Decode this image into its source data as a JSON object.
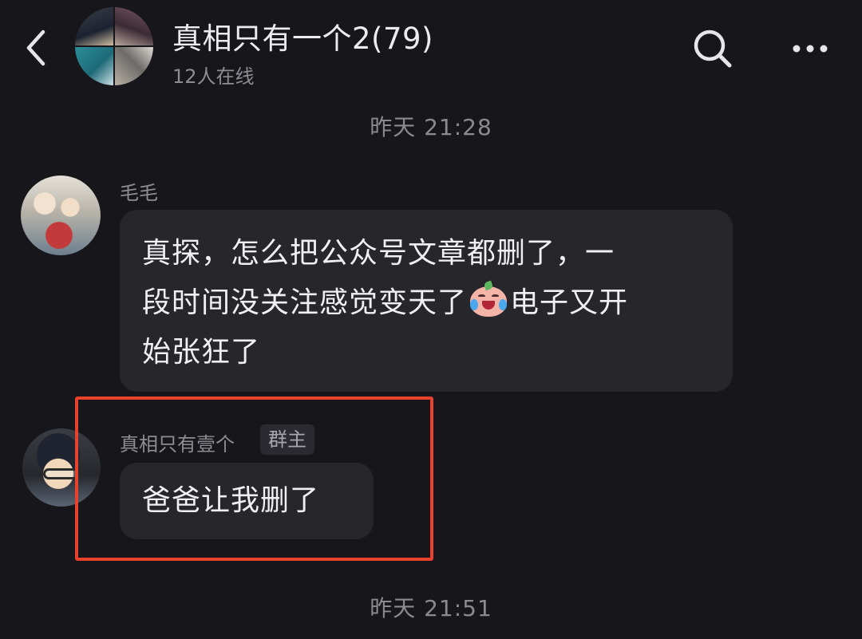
{
  "header": {
    "title": "真相只有一个2(79)",
    "online_status": "12人在线"
  },
  "messages": [
    {
      "timestamp": "昨天 21:28",
      "sender": "毛毛",
      "text_lines": [
        "真探，怎么把公众号文章都删了，一",
        "段时间没关注感觉变天了",
        "电子又开",
        "始张狂了"
      ],
      "emoji": "crying-laughing-face"
    },
    {
      "sender": "真相只有壹个",
      "role_badge": "群主",
      "text": "爸爸让我删了"
    }
  ],
  "footer_timestamp": "昨天 21:51",
  "colors": {
    "background": "#17171b",
    "bubble": "#26262b",
    "highlight": "#e8412e"
  }
}
